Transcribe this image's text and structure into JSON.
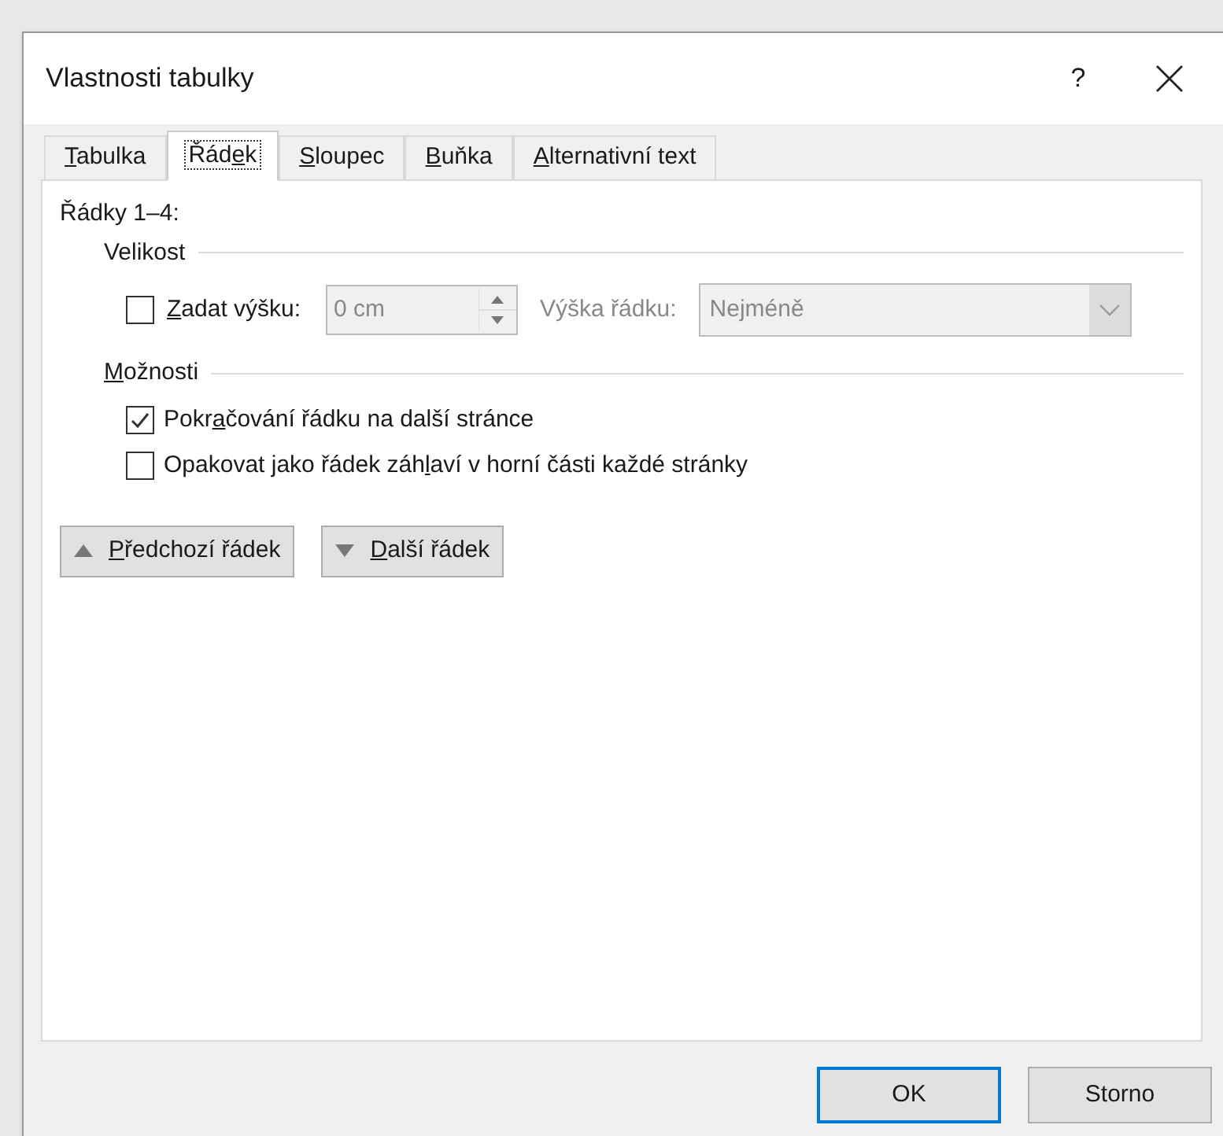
{
  "window": {
    "title": "Vlastnosti tabulky",
    "help": "?"
  },
  "tabs": [
    {
      "label": {
        "key": "T",
        "post": "abulka"
      },
      "selected": false
    },
    {
      "label": {
        "pre": "Řád",
        "key": "e",
        "post": "k"
      },
      "selected": true
    },
    {
      "label": {
        "key": "S",
        "post": "loupec"
      },
      "selected": false
    },
    {
      "label": {
        "key": "B",
        "post": "uňka"
      },
      "selected": false
    },
    {
      "label": {
        "key": "A",
        "post": "lternativní text"
      },
      "selected": false
    }
  ],
  "rows_heading": "Řádky 1–4:",
  "size": {
    "heading": "Velikost",
    "specify": {
      "label": {
        "key": "Z",
        "post": "adat výšku:"
      },
      "checked": false
    },
    "height_value": "0 cm",
    "height_value_disabled": true,
    "row_height_label": "Výška řádku:",
    "row_height_value": "Nejméně",
    "row_height_disabled": true
  },
  "options": {
    "heading": {
      "key": "M",
      "post": "ožnosti"
    },
    "items": [
      {
        "label": {
          "pre": "Pokr",
          "key": "a",
          "post": "čování řádku na další stránce"
        },
        "checked": true
      },
      {
        "label": {
          "pre": "Opakovat jako řádek záh",
          "key": "l",
          "post": "aví v horní části každé stránky"
        },
        "checked": false
      }
    ]
  },
  "nav_buttons": [
    {
      "kind": "up",
      "label": {
        "key": "P",
        "post": "ředchozí řádek"
      }
    },
    {
      "kind": "down",
      "label": {
        "key": "D",
        "post": "alší řádek"
      }
    }
  ],
  "buttons": [
    {
      "label": "OK",
      "selected": true
    },
    {
      "label": "Storno",
      "selected": false
    }
  ]
}
